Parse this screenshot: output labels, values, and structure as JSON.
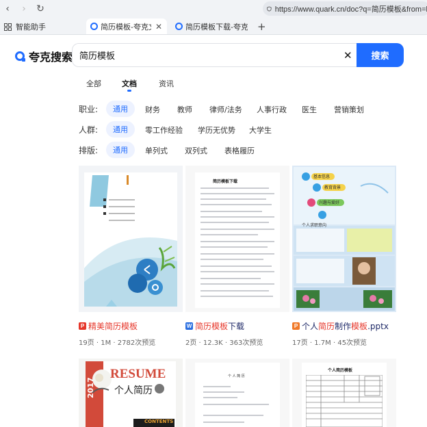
{
  "browser": {
    "url": "https://www.quark.cn/doc?q=简历模板&from=k",
    "assistant_label": "智能助手",
    "tabs": [
      {
        "label": "简历模板-夸克文档",
        "active": true
      },
      {
        "label": "简历模板下载-夸克文档",
        "active": false
      }
    ]
  },
  "header": {
    "logo_text": "夸克搜索",
    "search_value": "简历模板",
    "search_button": "搜索"
  },
  "nav_tabs": [
    "全部",
    "文档",
    "资讯"
  ],
  "filters": {
    "job": {
      "label": "职业:",
      "options": [
        "通用",
        "财务",
        "教师",
        "律师/法务",
        "人事行政",
        "医生",
        "营销策划"
      ]
    },
    "crowd": {
      "label": "人群:",
      "options": [
        "通用",
        "零工作经验",
        "学历无优势",
        "大学生"
      ]
    },
    "layout": {
      "label": "排版:",
      "options": [
        "通用",
        "单列式",
        "双列式",
        "表格履历"
      ]
    }
  },
  "results": [
    {
      "type": "pdf",
      "badge": "P",
      "badge_color": "#e6372b",
      "title_hl": "精美简历模板",
      "title_rest": "",
      "meta": "19页 · 1M · 2782次预览"
    },
    {
      "type": "word",
      "badge": "W",
      "badge_color": "#2b6fe0",
      "title_hl": "简历模板",
      "title_rest": "下载",
      "meta": "2页 · 12.3K · 363次预览"
    },
    {
      "type": "ppt",
      "badge": "P",
      "badge_color": "#f07a2a",
      "title_pre": "个人",
      "title_hl": "简历",
      "title_mid": "制作",
      "title_hl2": "模板",
      "title_rest": ".pptx",
      "meta": "17页 · 1.7M · 45次预览"
    }
  ],
  "thumbs": {
    "doc2_heading": "简历模板下载",
    "ppt_items": [
      "基本信息",
      "教育背景",
      "兴趣与爱好",
      "个人求职意向"
    ],
    "resume_big": "RESUME",
    "resume_sub": "个人简历",
    "resume_year": "2017",
    "resume_contents": "CONTENTS",
    "doc4_heading": "个 人 简 历",
    "doc5_heading": "个人简历模板"
  }
}
